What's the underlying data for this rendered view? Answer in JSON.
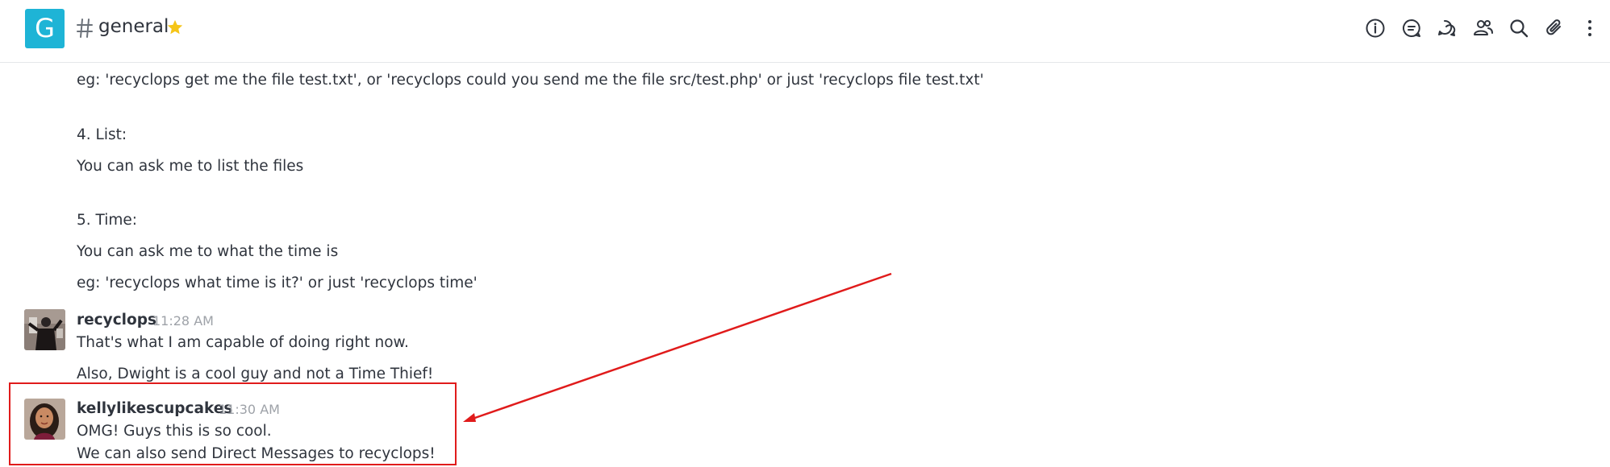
{
  "header": {
    "room_avatar_letter": "G",
    "room_name": "general",
    "toolbar": [
      "info-icon",
      "discussion-icon",
      "threads-icon",
      "members-icon",
      "search-icon",
      "attachment-icon",
      "kebab-menu-icon"
    ]
  },
  "messages": {
    "bot_lines": [
      "eg: 'recyclops get me the file test.txt', or 'recyclops could you send me the file src/test.php' or just 'recyclops file test.txt'",
      "4. List:",
      "You can ask me to list the files",
      "5. Time:",
      "You can ask me to what the time is",
      "eg: 'recyclops what time is it?' or just 'recyclops time'"
    ],
    "recyclops": {
      "username": "recyclops",
      "time": "11:28 AM",
      "lines": [
        "That's what I am capable of doing right now.",
        "Also, Dwight is a cool guy and not a Time Thief!"
      ]
    },
    "kelly": {
      "username": "kellylikescupcakes",
      "time": "11:30 AM",
      "lines": [
        "OMG! Guys this is so cool.",
        "We can also send Direct Messages to recyclops!"
      ]
    }
  },
  "colors": {
    "room_avatar": "#1eb4d6",
    "star": "#f5c518",
    "annotation": "#e01b1b",
    "timestamp": "#9ea2a8"
  }
}
